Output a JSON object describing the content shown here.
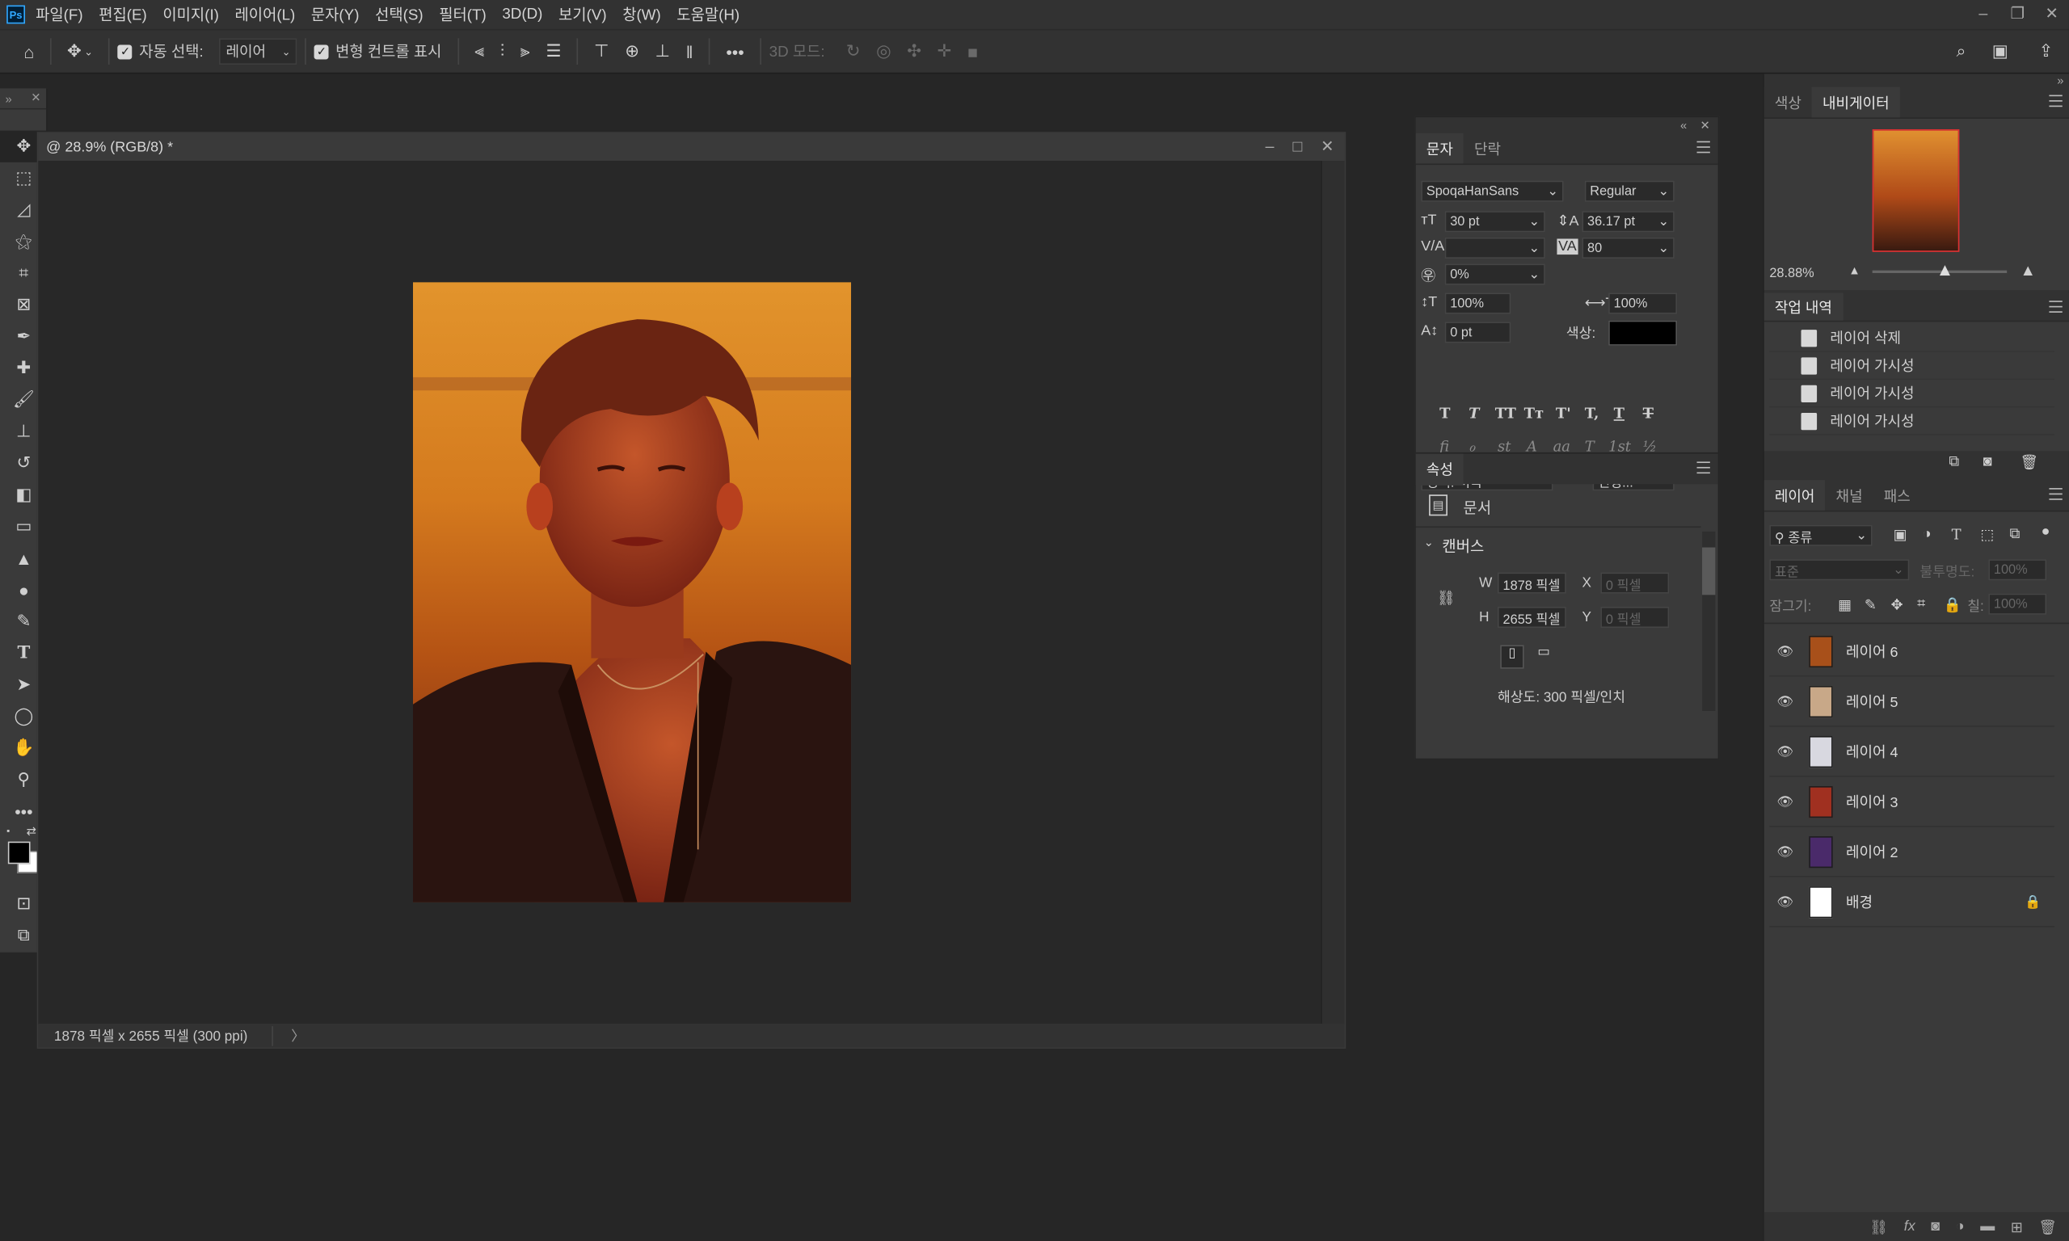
{
  "menubar": {
    "logo": "Ps",
    "items": [
      "파일(F)",
      "편집(E)",
      "이미지(I)",
      "레이어(L)",
      "문자(Y)",
      "선택(S)",
      "필터(T)",
      "3D(D)",
      "보기(V)",
      "창(W)",
      "도움말(H)"
    ]
  },
  "options": {
    "auto_select_label": "자동 선택:",
    "auto_select_value": "레이어",
    "transform_label": "변형 컨트롤 표시",
    "mode_3d": "3D 모드:"
  },
  "document": {
    "tab_title": "@ 28.9% (RGB/8) *",
    "status": "1878 픽셀 x 2655 픽셀 (300 ppi)",
    "status_arrow": "〉"
  },
  "character": {
    "tabs": [
      "문자",
      "단락"
    ],
    "font_family": "SpoqaHanSans",
    "font_style": "Regular",
    "size": "30 pt",
    "leading": "36.17 pt",
    "kerning": "",
    "tracking": "80",
    "tsume": "0%",
    "vscale": "100%",
    "hscale": "100%",
    "baseline": "0 pt",
    "color_label": "색상:",
    "color": "#000000",
    "language": "영어: 미국",
    "aa_label": "ªa",
    "antialias": "선명...",
    "glyph_row1": [
      "T",
      "T",
      "TT",
      "Tт",
      "T'",
      "T,",
      "T",
      "T"
    ],
    "glyph_row2": [
      "fi",
      "ℴ",
      "st",
      "A",
      "aa",
      "T",
      "1st",
      "½"
    ]
  },
  "properties": {
    "title": "속성",
    "doc_label": "문서",
    "canvas_label": "캔버스",
    "w_label": "W",
    "w_value": "1878 픽셀",
    "h_label": "H",
    "h_value": "2655 픽셀",
    "x_label": "X",
    "x_value": "0 픽셀",
    "y_label": "Y",
    "y_value": "0 픽셀",
    "resolution": "해상도: 300 픽셀/인치"
  },
  "navigator": {
    "tabs": [
      "색상",
      "내비게이터"
    ],
    "zoom": "28.88%",
    "zoom_fraction": 0.5
  },
  "history": {
    "title": "작업 내역",
    "items": [
      "레이어 삭제",
      "레이어 가시성",
      "레이어 가시성",
      "레이어 가시성"
    ]
  },
  "layers": {
    "tabs": [
      "레이어",
      "채널",
      "패스"
    ],
    "filter": "종류",
    "blend": "표준",
    "opacity_label": "불투명도:",
    "opacity": "100%",
    "lock_label": "잠그기:",
    "fill_label": "칠:",
    "fill": "100%",
    "items": [
      {
        "name": "레이어 6",
        "thumb": "#a8501a"
      },
      {
        "name": "레이어 5",
        "thumb": "#c8a888"
      },
      {
        "name": "레이어 4",
        "thumb": "#d8d8e0"
      },
      {
        "name": "레이어 3",
        "thumb": "#a03020"
      },
      {
        "name": "레이어 2",
        "thumb": "#4a2a6a"
      },
      {
        "name": "배경",
        "thumb": "#ffffff"
      }
    ]
  },
  "colors": {
    "accent": "#31a8ff",
    "panel": "#3a3a3a",
    "bg": "#262626"
  }
}
